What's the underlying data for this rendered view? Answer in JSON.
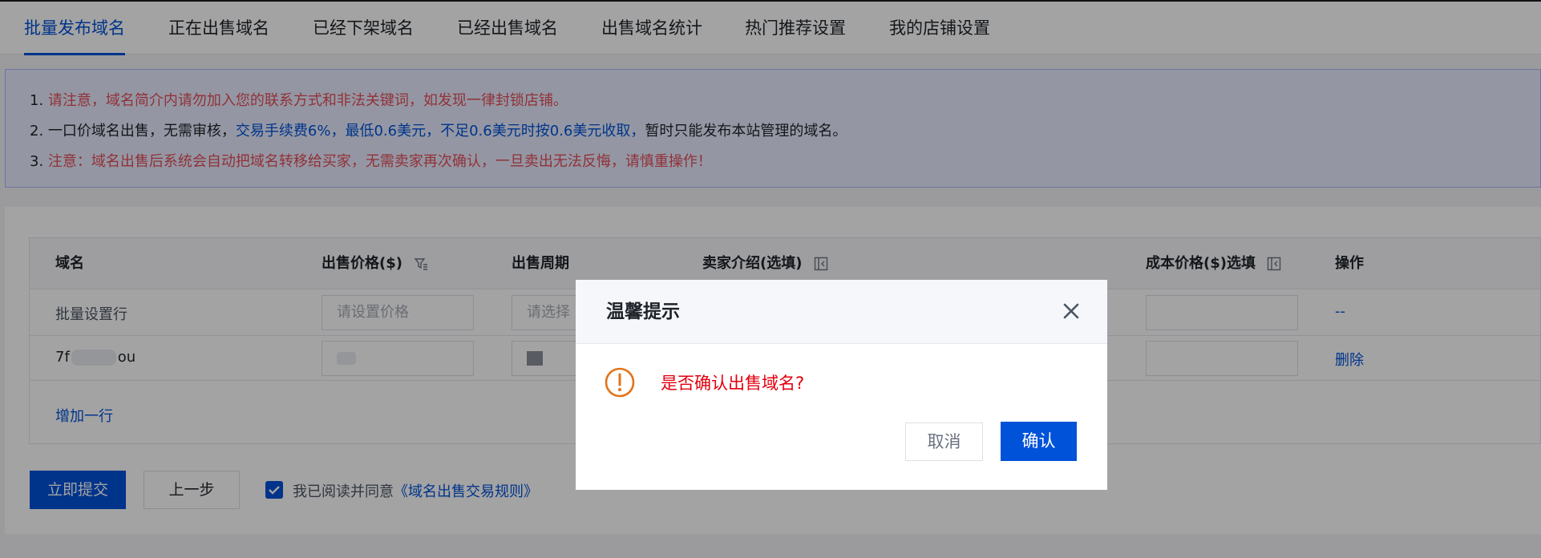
{
  "tabs": [
    {
      "label": "批量发布域名",
      "active": true
    },
    {
      "label": "正在出售域名"
    },
    {
      "label": "已经下架域名"
    },
    {
      "label": "已经出售域名"
    },
    {
      "label": "出售域名统计"
    },
    {
      "label": "热门推荐设置"
    },
    {
      "label": "我的店铺设置"
    }
  ],
  "notice": {
    "line1": {
      "num": "1.",
      "text": "请注意，域名简介内请勿加入您的联系方式和非法关键词，如发现一律封锁店铺。"
    },
    "line2": {
      "num": "2.",
      "part1": "一口价域名出售，无需审核，",
      "part2": "交易手续费6%，最低0.6美元，不足0.6美元时按0.6美元收取，",
      "part3": "暂时只能发布本站管理的域名。"
    },
    "line3": {
      "num": "3.",
      "text": "注意：域名出售后系统会自动把域名转移给买家，无需卖家再次确认，一旦卖出无法反悔，请慎重操作！"
    }
  },
  "table": {
    "headers": {
      "domain": "域名",
      "price": "出售价格($)",
      "period": "出售周期",
      "intro": "卖家介绍(选填)",
      "cost": "成本价格($)选填",
      "action": "操作"
    },
    "batch_row": {
      "label": "批量设置行",
      "price_placeholder": "请设置价格",
      "period_placeholder": "请选择",
      "action": "--"
    },
    "domain_row": {
      "domain_prefix": "7f",
      "domain_suffix": "ou",
      "action": "删除"
    },
    "add_row": "增加一行"
  },
  "footer": {
    "submit": "立即提交",
    "prev": "上一步",
    "agree": "我已阅读并同意",
    "rules_link": "《域名出售交易规则》"
  },
  "dialog": {
    "title": "温馨提示",
    "message": "是否确认出售域名?",
    "cancel": "取消",
    "confirm": "确认"
  },
  "colors": {
    "primary": "#0052d9",
    "warning": "#e37318",
    "danger": "#e34d59"
  }
}
